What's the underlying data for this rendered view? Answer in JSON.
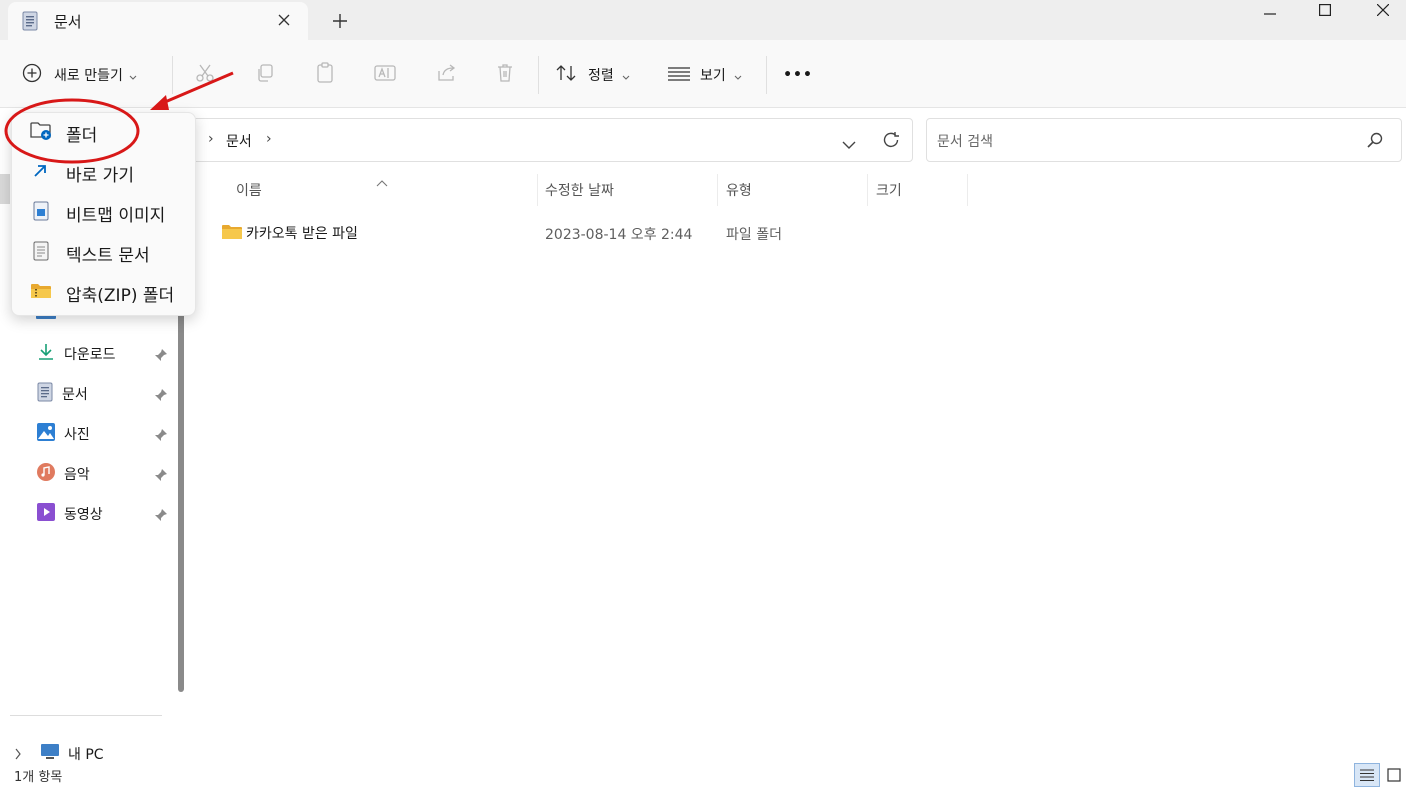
{
  "tab": {
    "title": "문서"
  },
  "toolbar": {
    "new_label": "새로 만들기",
    "sort_label": "정렬",
    "view_label": "보기",
    "more_label": "•••"
  },
  "address": {
    "path": "문서"
  },
  "search": {
    "placeholder": "문서 검색"
  },
  "columns": [
    "이름",
    "수정한 날짜",
    "유형",
    "크기"
  ],
  "files": [
    {
      "name": "카카오톡 받은 파일",
      "modified": "2023-08-14 오후 2:44",
      "type": "파일 폴더",
      "size": ""
    }
  ],
  "new_menu": [
    {
      "label": "폴더",
      "icon": "new-folder-icon"
    },
    {
      "label": "바로 가기",
      "icon": "shortcut-icon"
    },
    {
      "label": "비트맵 이미지",
      "icon": "bitmap-icon"
    },
    {
      "label": "텍스트 문서",
      "icon": "text-document-icon"
    },
    {
      "label": "압축(ZIP) 폴더",
      "icon": "zip-folder-icon"
    }
  ],
  "sidebar": {
    "items": [
      {
        "label": "다운로드",
        "icon": "download-icon"
      },
      {
        "label": "문서",
        "icon": "document-icon"
      },
      {
        "label": "사진",
        "icon": "pictures-icon"
      },
      {
        "label": "음악",
        "icon": "music-icon"
      },
      {
        "label": "동영상",
        "icon": "video-icon"
      }
    ],
    "pc_label": "내 PC"
  },
  "status": {
    "item_count": "1개 항목"
  },
  "colors": {
    "annotation": "#d81818",
    "folder": "#f2c14e",
    "accent": "#0067c0"
  }
}
